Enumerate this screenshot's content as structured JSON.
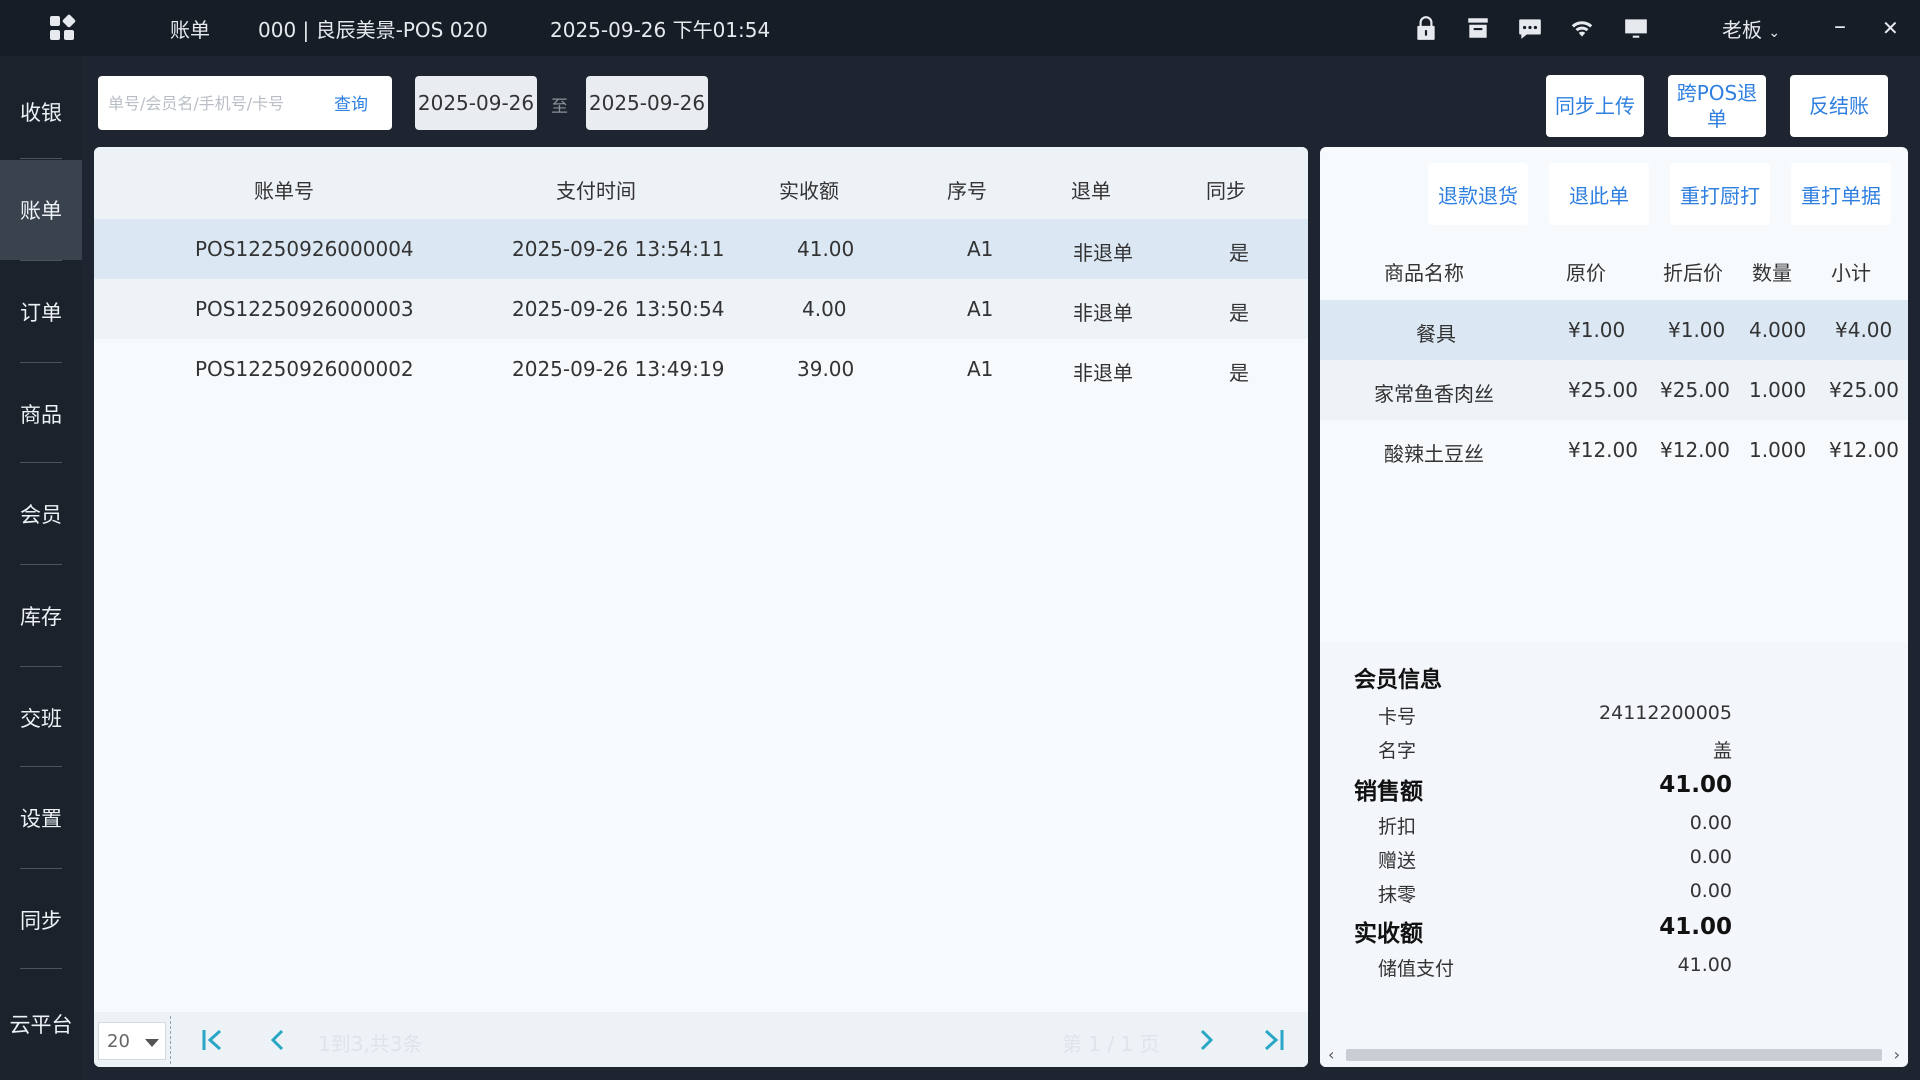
{
  "topbar": {
    "module": "账单",
    "store": "000 | 良辰美景-POS 020",
    "datetime": "2025-09-26 下午01:54",
    "user": "老板",
    "minimize": "–",
    "close": "✕"
  },
  "sidebar": {
    "items": [
      {
        "label": "收银"
      },
      {
        "label": "账单"
      },
      {
        "label": "订单"
      },
      {
        "label": "商品"
      },
      {
        "label": "会员"
      },
      {
        "label": "库存"
      },
      {
        "label": "交班"
      },
      {
        "label": "设置"
      },
      {
        "label": "同步"
      },
      {
        "label": "云平台"
      }
    ],
    "active_index": 1
  },
  "toolbar": {
    "search_placeholder": "单号/会员名/手机号/卡号",
    "search_label": "查询",
    "date_from": "2025-09-26",
    "date_sep": "至",
    "date_to": "2025-09-26",
    "sync_upload": "同步上传",
    "cross_pos_refund": "跨POS退单",
    "reverse_checkout": "反结账"
  },
  "bill_table": {
    "columns": [
      "账单号",
      "支付时间",
      "实收额",
      "序号",
      "退单",
      "同步"
    ],
    "rows": [
      [
        "POS12250926000004",
        "2025-09-26 13:54:11",
        "41.00",
        "A1",
        "非退单",
        "是"
      ],
      [
        "POS12250926000003",
        "2025-09-26 13:50:54",
        "4.00",
        "A1",
        "非退单",
        "是"
      ],
      [
        "POS12250926000002",
        "2025-09-26 13:49:19",
        "39.00",
        "A1",
        "非退单",
        "是"
      ]
    ],
    "selected_row": 0
  },
  "pager": {
    "page_size": "20",
    "range_text": "1到3,共3条",
    "page_text": "第 1 / 1 页"
  },
  "detail": {
    "buttons": {
      "refund_return": "退款退货",
      "refund_bill": "退此单",
      "reprint_kitchen": "重打厨打",
      "reprint_receipt": "重打单据"
    },
    "goods_columns": [
      "商品名称",
      "原价",
      "折后价",
      "数量",
      "小计"
    ],
    "goods_rows": [
      [
        "餐具",
        "¥1.00",
        "¥1.00",
        "4.000",
        "¥4.00"
      ],
      [
        "家常鱼香肉丝",
        "¥25.00",
        "¥25.00",
        "1.000",
        "¥25.00"
      ],
      [
        "酸辣土豆丝",
        "¥12.00",
        "¥12.00",
        "1.000",
        "¥12.00"
      ]
    ],
    "summary": {
      "member_info_title": "会员信息",
      "card_no_label": "卡号",
      "card_no": "24112200005",
      "name_label": "名字",
      "name": "盖",
      "sales_label": "销售额",
      "sales": "41.00",
      "discount_label": "折扣",
      "discount": "0.00",
      "gift_label": "赠送",
      "gift": "0.00",
      "rounding_label": "抹零",
      "rounding": "0.00",
      "received_label": "实收额",
      "received": "41.00",
      "stored_value_label": "储值支付",
      "stored_value": "41.00"
    }
  }
}
